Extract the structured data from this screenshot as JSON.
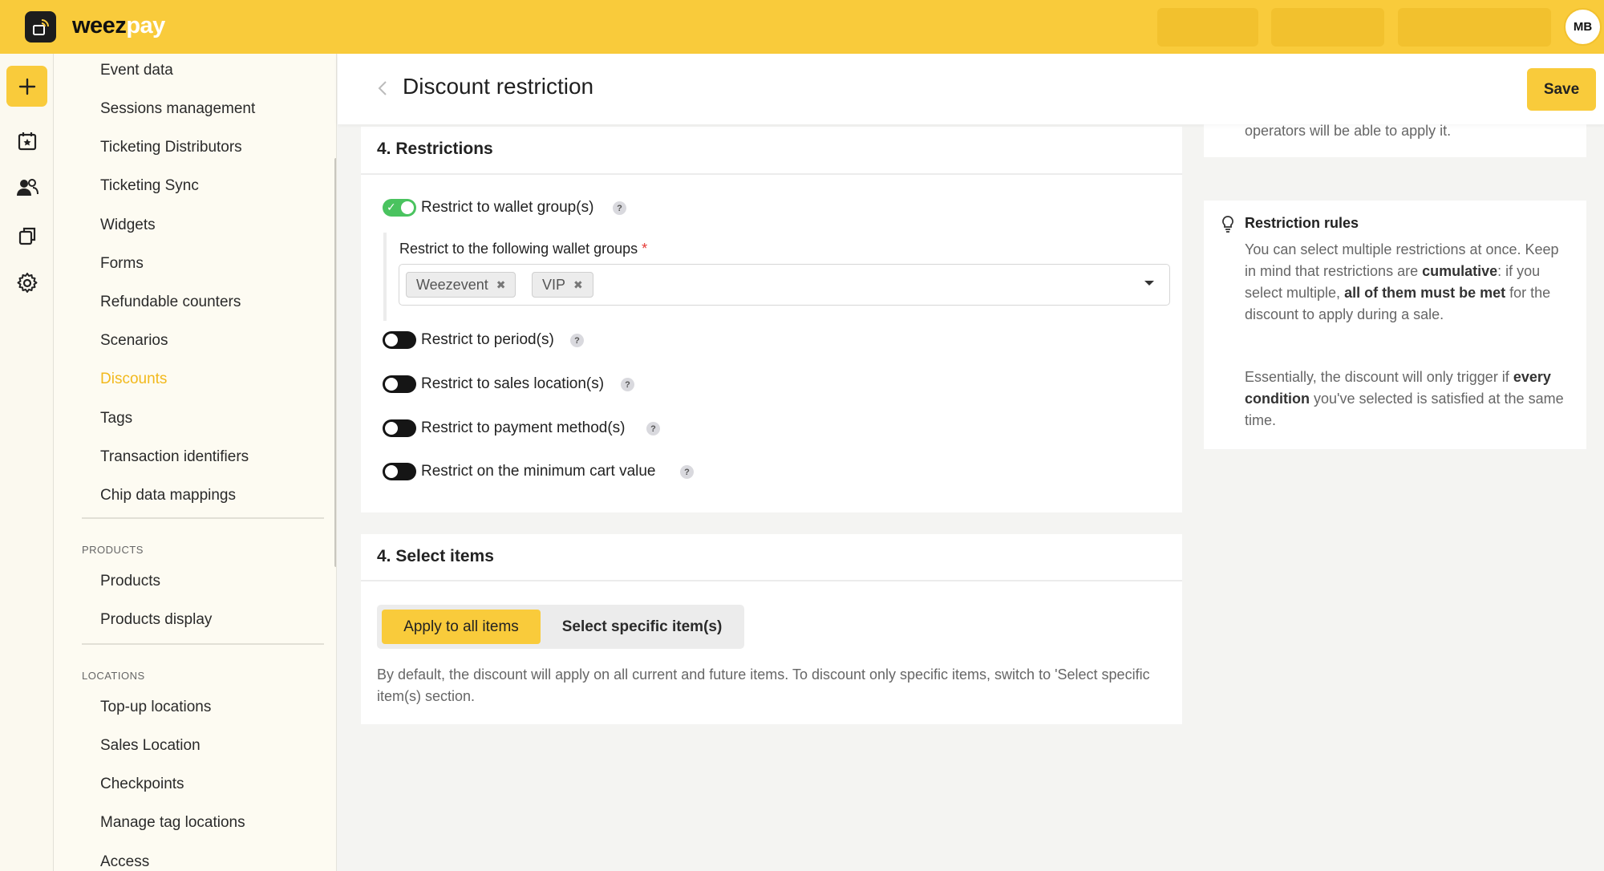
{
  "app": {
    "brand_part1": "weez",
    "brand_part2": "pay",
    "user_initials": "MB",
    "accent_color": "#f9cb3b"
  },
  "header": {
    "title": "Discount restriction",
    "save_label": "Save"
  },
  "sidebar": {
    "items": [
      {
        "label": "Event data"
      },
      {
        "label": "Sessions management"
      },
      {
        "label": "Ticketing Distributors"
      },
      {
        "label": "Ticketing Sync"
      },
      {
        "label": "Widgets"
      },
      {
        "label": "Forms"
      },
      {
        "label": "Refundable counters"
      },
      {
        "label": "Scenarios"
      },
      {
        "label": "Discounts",
        "active": true
      },
      {
        "label": "Tags"
      },
      {
        "label": "Transaction identifiers"
      },
      {
        "label": "Chip data mappings"
      }
    ],
    "products_section": "PRODUCTS",
    "products_items": [
      {
        "label": "Products"
      },
      {
        "label": "Products display"
      }
    ],
    "locations_section": "LOCATIONS",
    "locations_items": [
      {
        "label": "Top-up locations"
      },
      {
        "label": "Sales Location"
      },
      {
        "label": "Checkpoints"
      },
      {
        "label": "Manage tag locations"
      },
      {
        "label": "Access"
      }
    ]
  },
  "restrictions": {
    "title": "4. Restrictions",
    "wallet_toggle_label": "Restrict to wallet group(s)",
    "wallet_field_label": "Restrict to the following wallet groups",
    "wallet_required_mark": "*",
    "wallet_tags": [
      "Weezevent",
      "VIP"
    ],
    "options": [
      {
        "label": "Restrict to period(s)",
        "on": false
      },
      {
        "label": "Restrict to sales location(s)",
        "on": false
      },
      {
        "label": "Restrict to payment method(s)",
        "on": false
      },
      {
        "label": "Restrict on the minimum cart value",
        "on": false
      }
    ],
    "help_glyph": "?"
  },
  "select_items": {
    "title": "4. Select items",
    "apply_all_label": "Apply to all items",
    "select_specific_label": "Select specific item(s)",
    "description": "By default, the discount will apply on all current and future items. To discount only specific items, switch to 'Select specific item(s) section."
  },
  "right_panel": {
    "top_text": "operators will be able to apply it.",
    "tip_title": "Restriction rules",
    "tip_p1_a": "You can select multiple restrictions at once. Keep in mind that restrictions are ",
    "tip_p1_b": "cumulative",
    "tip_p1_c": ": if you select multiple, ",
    "tip_p1_d": "all of them must be met",
    "tip_p1_e": " for the discount to apply during a sale.",
    "tip_p2_a": "Essentially, the discount will only trigger if ",
    "tip_p2_b": "every condition",
    "tip_p2_c": " you've selected is satisfied at the same time."
  }
}
